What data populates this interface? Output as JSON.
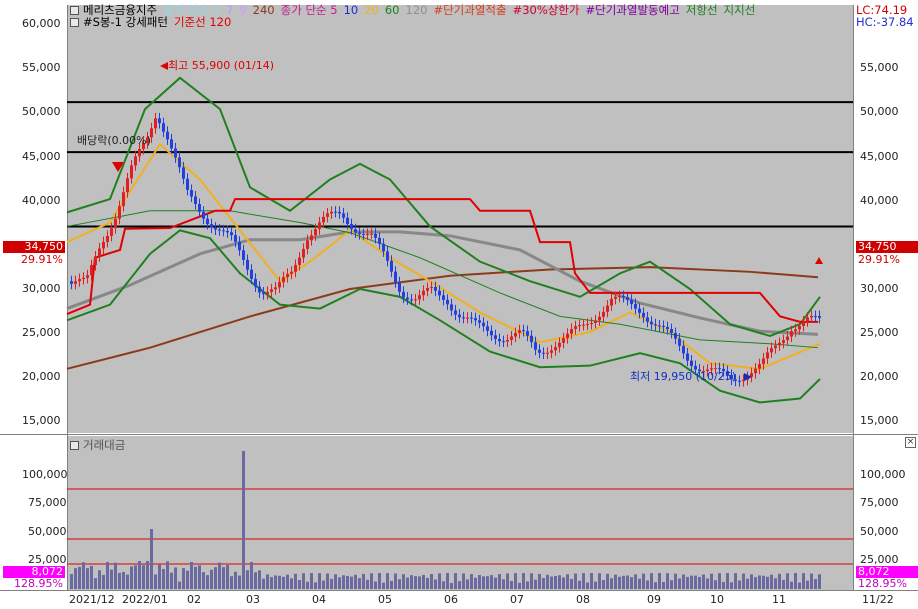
{
  "legend": {
    "line1": [
      {
        "text": "메리츠금융지주",
        "color": "#000000"
      },
      {
        "text": "종가 단순 3",
        "color": "#8fd8e8"
      },
      {
        "text": "7",
        "color": "#9fa8ff"
      },
      {
        "text": "9",
        "color": "#c8a0ff"
      },
      {
        "text": "240",
        "color": "#8b3a1a"
      },
      {
        "text": "종가 단순 5",
        "color": "#c02090"
      },
      {
        "text": "10",
        "color": "#2030d0"
      },
      {
        "text": "20",
        "color": "#f0b020"
      },
      {
        "text": "60",
        "color": "#208020"
      },
      {
        "text": "120",
        "color": "#909090"
      },
      {
        "text": "#단기과열적출",
        "color": "#d04020"
      },
      {
        "text": "#30%상한가",
        "color": "#d00030"
      },
      {
        "text": "#단기과열발동예고",
        "color": "#8000a0"
      },
      {
        "text": "저항선",
        "color": "#208020"
      },
      {
        "text": "지지선",
        "color": "#208020"
      }
    ],
    "line2": [
      {
        "text": "#S봉-1 강세패턴",
        "color": "#000000"
      },
      {
        "text": "기준선 120",
        "color": "#e00000"
      }
    ]
  },
  "indicators": {
    "lc": "LC:74.19",
    "hc": "HC:-37.84",
    "close_label": "34,750",
    "close_pct": "29.91%"
  },
  "annotations": {
    "high": "최고 55,900 (01/14)",
    "low": "최저 19,950 (10/25)",
    "dividend": "배당락(0.00%)"
  },
  "price_axis": {
    "ticks": [
      "60,000",
      "55,000",
      "50,000",
      "45,000",
      "40,000",
      "35,000",
      "30,000",
      "25,000",
      "20,000",
      "15,000"
    ],
    "right_ticks": [
      "55,000",
      "50,000",
      "45,000",
      "40,000",
      "35,000",
      "30,000",
      "25,000",
      "20,000",
      "15,000"
    ]
  },
  "volume": {
    "title": "거래대금",
    "ticks": [
      "100,000",
      "75,000",
      "50,000",
      "25,000"
    ],
    "current": "8,072",
    "pct": "128.95%"
  },
  "dates": [
    "2021/12",
    "2022/01",
    "02",
    "03",
    "04",
    "05",
    "06",
    "07",
    "08",
    "09",
    "10",
    "11",
    "11/22"
  ],
  "colors": {
    "bg": "#c0c0c0",
    "up": "#e02020",
    "down": "#2040e0",
    "volume": "#6a6aa0",
    "resist": "#000000"
  }
}
